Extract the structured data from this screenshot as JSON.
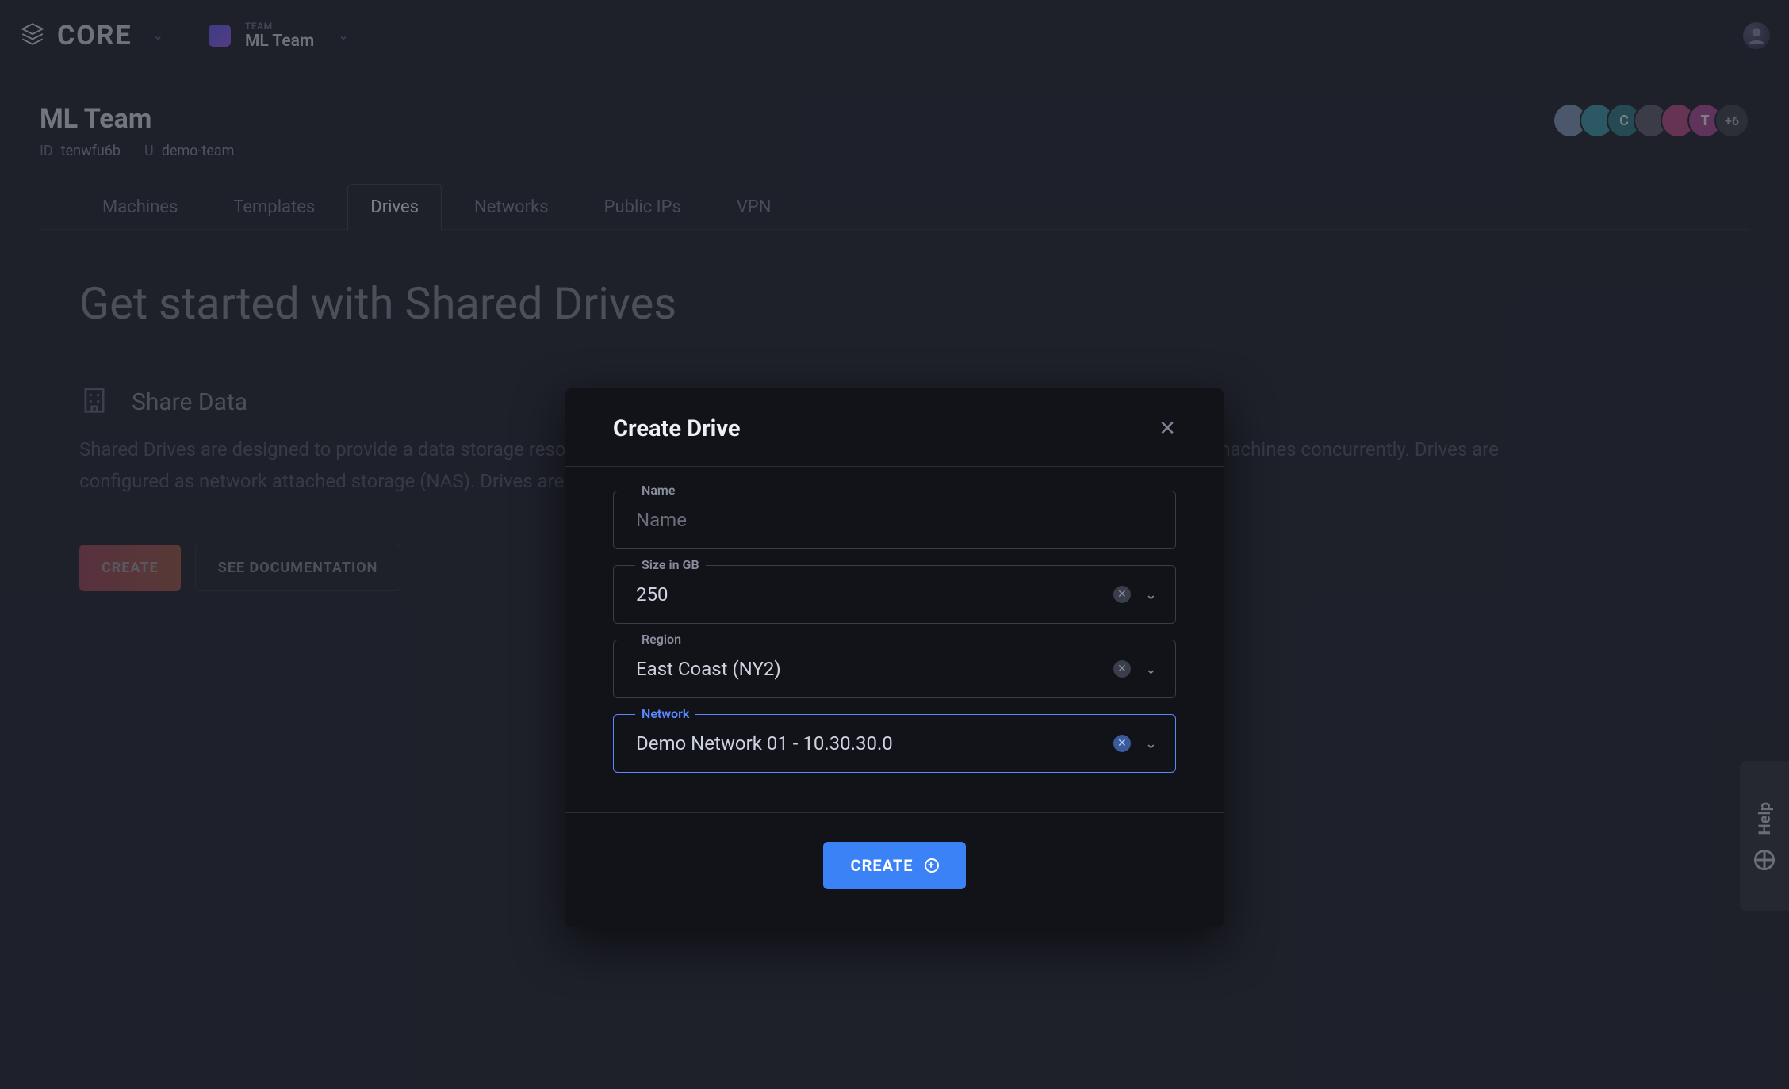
{
  "brand": {
    "name": "CORE"
  },
  "team_switcher": {
    "label": "TEAM",
    "name": "ML Team"
  },
  "page": {
    "title": "ML Team",
    "id_key": "ID",
    "id_value": "tenwfu6b",
    "slug_key": "U",
    "slug_value": "demo-team"
  },
  "members": {
    "avatars": [
      "",
      "",
      "C",
      "",
      "",
      "T"
    ],
    "overflow": "+6"
  },
  "tabs": [
    {
      "label": "Machines",
      "active": false
    },
    {
      "label": "Templates",
      "active": false
    },
    {
      "label": "Drives",
      "active": true
    },
    {
      "label": "Networks",
      "active": false
    },
    {
      "label": "Public IPs",
      "active": false
    },
    {
      "label": "VPN",
      "active": false
    }
  ],
  "content": {
    "headline": "Get started with Shared Drives",
    "section_title": "Share Data",
    "section_body": "Shared Drives are designed to provide a data storage resource that behaves similarly to a local office file server (referred to as multiple machines concurrently. Drives are configured as network attached storage (NAS). Drives are mounted using standard between machines.",
    "create_btn": "CREATE",
    "docs_btn": "SEE DOCUMENTATION"
  },
  "modal": {
    "title": "Create Drive",
    "fields": {
      "name": {
        "label": "Name",
        "placeholder": "Name",
        "value": ""
      },
      "size": {
        "label": "Size in GB",
        "value": "250"
      },
      "region": {
        "label": "Region",
        "value": "East Coast (NY2)"
      },
      "network": {
        "label": "Network",
        "value": "Demo Network 01 - 10.30.30.0"
      }
    },
    "submit": "CREATE"
  },
  "help": {
    "label": "Help"
  }
}
